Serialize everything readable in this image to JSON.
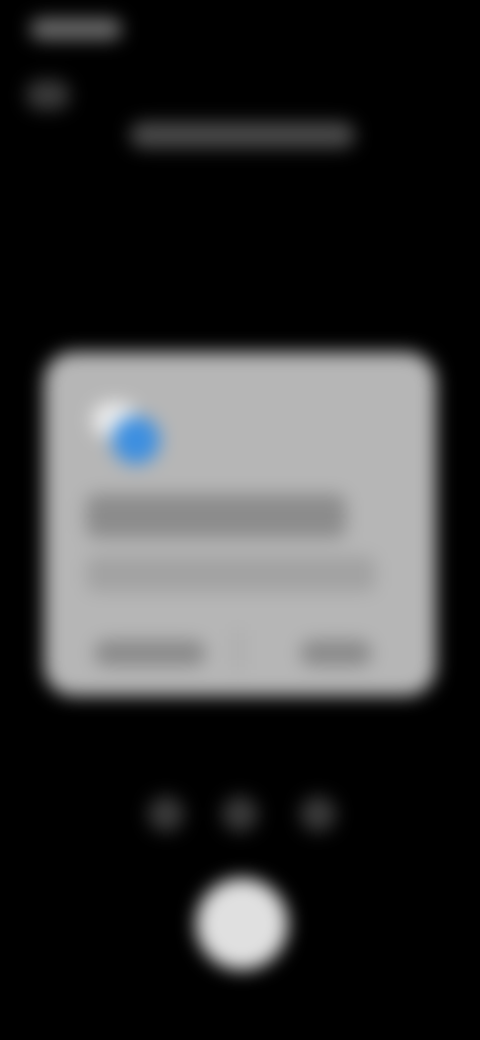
{
  "status_bar": {
    "time": "",
    "indicator": ""
  },
  "header": {
    "title": ""
  },
  "dialog": {
    "icon": "cloud-badge-icon",
    "accent": "#3d8fe0",
    "title": "",
    "message": "",
    "negative_button": "",
    "positive_button": ""
  },
  "camera": {
    "modes": [
      "",
      "",
      ""
    ],
    "shutter_icon": "shutter-icon"
  }
}
